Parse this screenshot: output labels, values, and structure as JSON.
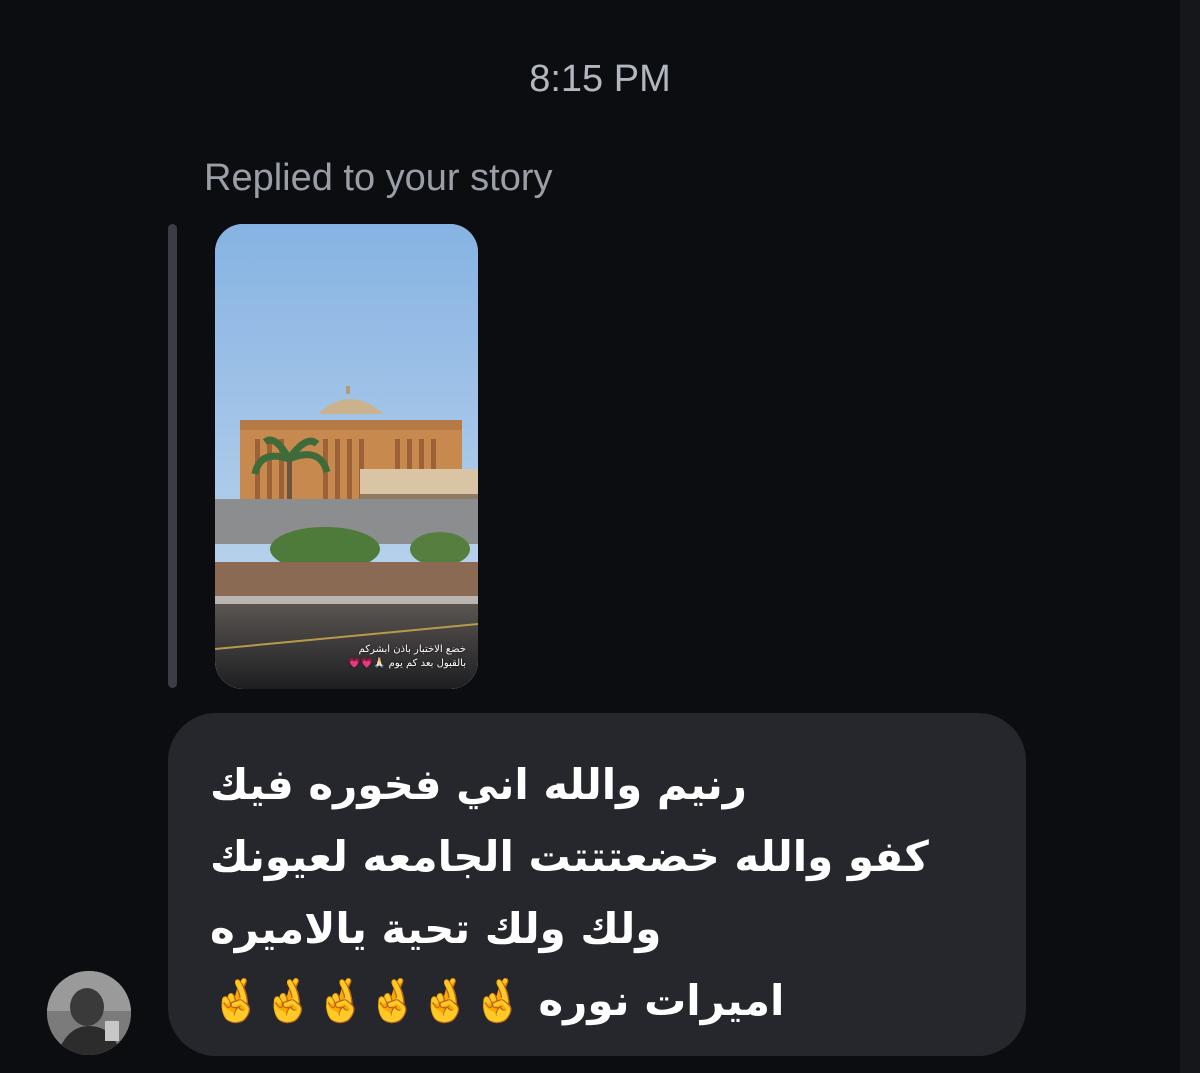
{
  "thread": {
    "timestamp": "8:15 PM"
  },
  "reply": {
    "label": "Replied to your story",
    "story_caption_line1": "خضع الاختبار باذن ابشركم",
    "story_caption_line2": "بالقبول بعد كم يوم 🙏🏻💗💗"
  },
  "message": {
    "lines": [
      "رنيم والله اني فخوره فيك",
      "كفو والله خضعتتتت الجامعه لعيونك",
      "ولك ولك تحية يالاميره",
      "اميرات نوره 🤞🤞🤞🤞🤞🤞"
    ]
  },
  "sender": {
    "avatar_icon": "user-avatar-photo"
  },
  "colors": {
    "background": "#0b0d11",
    "bubble": "#25272c",
    "timestamp_text": "#b2b6bf",
    "label_text": "#9a9ea7",
    "reply_bar": "#3a3d44"
  }
}
